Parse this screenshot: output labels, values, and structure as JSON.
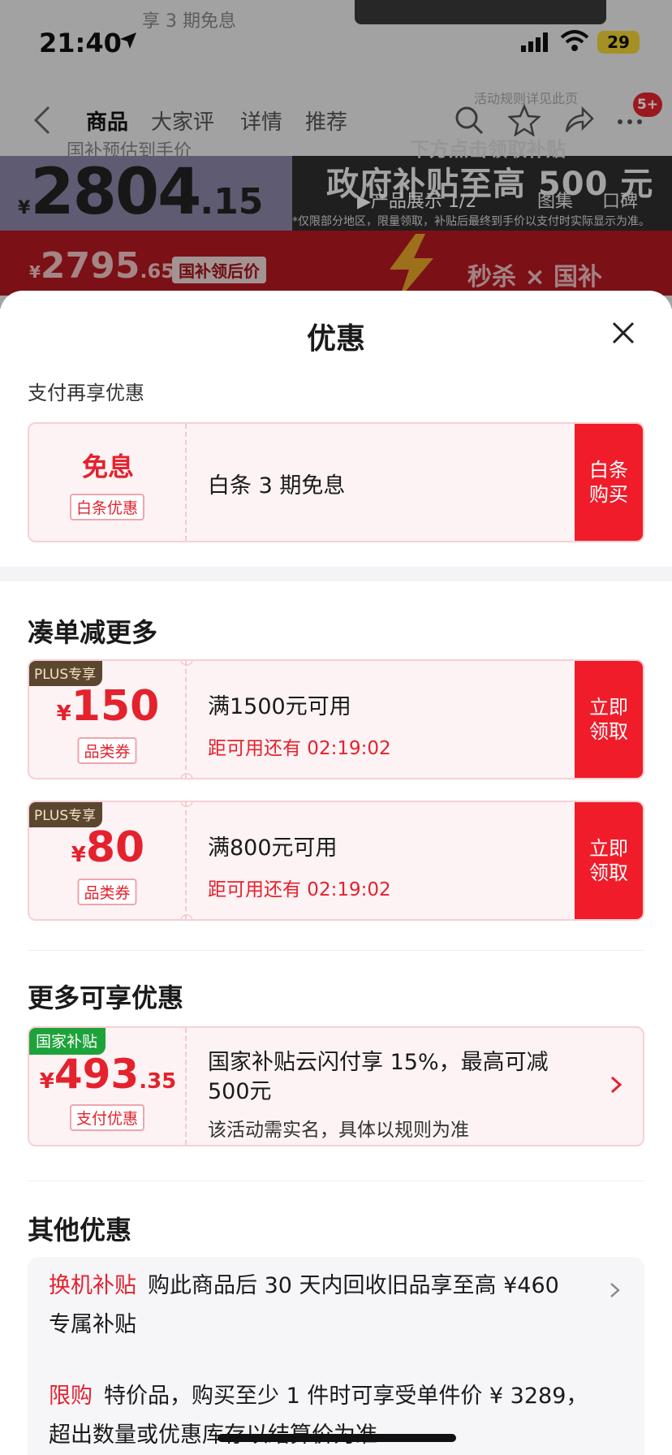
{
  "background": {
    "top_hint": "享 3 期免息",
    "status_bar": {
      "time": "21:40",
      "battery": "29"
    },
    "tabs": [
      "商品",
      "大家评",
      "详情",
      "推荐"
    ],
    "cart_badge": "5+",
    "side_hint": "活动规则详见此页",
    "sub_label": "国补预估到手价",
    "claim_hint": "下方点击领取补贴",
    "price": {
      "currency": "¥",
      "int": "2804",
      "dec": ".15"
    },
    "gov_title": "政府补贴至高 500 元",
    "product_show": "▶产品展示 1/2",
    "gallery": "图集",
    "reviews": "口碑",
    "footnote": "*仅限部分地区，限量领取，补贴后最终到手价以支付时实际显示为准。",
    "price2": {
      "currency": "¥",
      "int": "2795",
      "dec": ".65",
      "tag": "国补领后价"
    },
    "flash": "秒杀 × 国补"
  },
  "sheet": {
    "title": "优惠",
    "pay_section": {
      "title": "支付再享优惠",
      "card": {
        "main": "免息",
        "tag": "白条优惠",
        "text": "白条 3 期免息",
        "action": "白条购买"
      }
    },
    "bundle_section": {
      "title": "凑单减更多",
      "coupons": [
        {
          "plus": "PLUS专享",
          "currency": "¥",
          "amount": "150",
          "tag": "品类券",
          "condition": "满1500元可用",
          "countdown": "距可用还有 02:19:02",
          "action": "立即领取"
        },
        {
          "plus": "PLUS专享",
          "currency": "¥",
          "amount": "80",
          "tag": "品类券",
          "condition": "满800元可用",
          "countdown": "距可用还有 02:19:02",
          "action": "立即领取"
        }
      ]
    },
    "more_section": {
      "title": "更多可享优惠",
      "card": {
        "badge": "国家补贴",
        "currency": "¥",
        "int": "493",
        "dec": ".35",
        "tag": "支付优惠",
        "line1": "国家补贴云闪付享 15%，最高可减",
        "line2": "500元",
        "note": "该活动需实名，具体以规则为准"
      }
    },
    "other_section": {
      "title": "其他优惠",
      "items": [
        {
          "label": "换机补贴",
          "line1": "购此商品后 30 天内回收旧品享至高 ¥460",
          "line2": "专属补贴"
        },
        {
          "label": "限购",
          "line1": "特价品，购买至少 1 件时可享受单件价 ¥ 3289，",
          "line2": "超出数量或优惠库存以结算价为准"
        }
      ]
    }
  },
  "colors": {
    "accent_red": "#e4222e",
    "action_red": "#f01c2a",
    "plus_brown": "#5b4630",
    "gov_green": "#1ea33b"
  }
}
